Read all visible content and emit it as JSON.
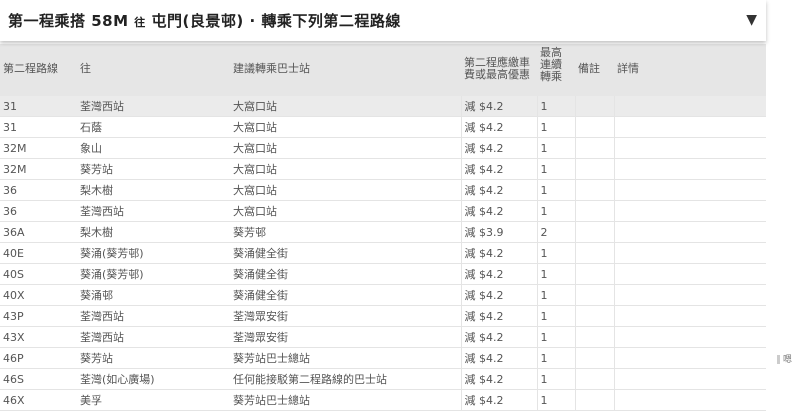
{
  "header": {
    "title_prefix": "第一程乘搭",
    "route": "58M",
    "to_word": "往",
    "destination": "屯門(良景邨)",
    "separator": "·",
    "suffix": "轉乘下列第二程路線",
    "toggle_icon": "▼"
  },
  "columns": {
    "route": "第二程路線",
    "to": "往",
    "stop": "建議轉乘巴士站",
    "fare_l1": "第二程應繳車",
    "fare_l2": "費或最高優惠",
    "max_l1": "最高",
    "max_l2": "連續",
    "max_l3": "轉乘",
    "note": "備註",
    "detail": "詳情"
  },
  "rows": [
    {
      "route": "31",
      "to": "荃灣西站",
      "stop": "大窩口站",
      "fare": "減 $4.2",
      "max": "1",
      "note": "",
      "detail": ""
    },
    {
      "route": "31",
      "to": "石蔭",
      "stop": "大窩口站",
      "fare": "減 $4.2",
      "max": "1",
      "note": "",
      "detail": ""
    },
    {
      "route": "32M",
      "to": "象山",
      "stop": "大窩口站",
      "fare": "減 $4.2",
      "max": "1",
      "note": "",
      "detail": ""
    },
    {
      "route": "32M",
      "to": "葵芳站",
      "stop": "大窩口站",
      "fare": "減 $4.2",
      "max": "1",
      "note": "",
      "detail": ""
    },
    {
      "route": "36",
      "to": "梨木樹",
      "stop": "大窩口站",
      "fare": "減 $4.2",
      "max": "1",
      "note": "",
      "detail": ""
    },
    {
      "route": "36",
      "to": "荃灣西站",
      "stop": "大窩口站",
      "fare": "減 $4.2",
      "max": "1",
      "note": "",
      "detail": ""
    },
    {
      "route": "36A",
      "to": "梨木樹",
      "stop": "葵芳邨",
      "fare": "減 $3.9",
      "max": "2",
      "note": "",
      "detail": ""
    },
    {
      "route": "40E",
      "to": "葵涌(葵芳邨)",
      "stop": "葵涌健全街",
      "fare": "減 $4.2",
      "max": "1",
      "note": "",
      "detail": ""
    },
    {
      "route": "40S",
      "to": "葵涌(葵芳邨)",
      "stop": "葵涌健全街",
      "fare": "減 $4.2",
      "max": "1",
      "note": "",
      "detail": ""
    },
    {
      "route": "40X",
      "to": "葵涌邨",
      "stop": "葵涌健全街",
      "fare": "減 $4.2",
      "max": "1",
      "note": "",
      "detail": ""
    },
    {
      "route": "43P",
      "to": "荃灣西站",
      "stop": "荃灣眾安街",
      "fare": "減 $4.2",
      "max": "1",
      "note": "",
      "detail": ""
    },
    {
      "route": "43X",
      "to": "荃灣西站",
      "stop": "荃灣眾安街",
      "fare": "減 $4.2",
      "max": "1",
      "note": "",
      "detail": ""
    },
    {
      "route": "46P",
      "to": "葵芳站",
      "stop": "葵芳站巴士總站",
      "fare": "減 $4.2",
      "max": "1",
      "note": "",
      "detail": ""
    },
    {
      "route": "46S",
      "to": "荃灣(如心廣場)",
      "stop": "任何能接駁第二程路線的巴士站",
      "fare": "減 $4.2",
      "max": "1",
      "note": "",
      "detail": ""
    },
    {
      "route": "46X",
      "to": "美孚",
      "stop": "葵芳站巴士總站",
      "fare": "減 $4.2",
      "max": "1",
      "note": "",
      "detail": ""
    }
  ],
  "side_tab": {
    "label": "嗯"
  }
}
